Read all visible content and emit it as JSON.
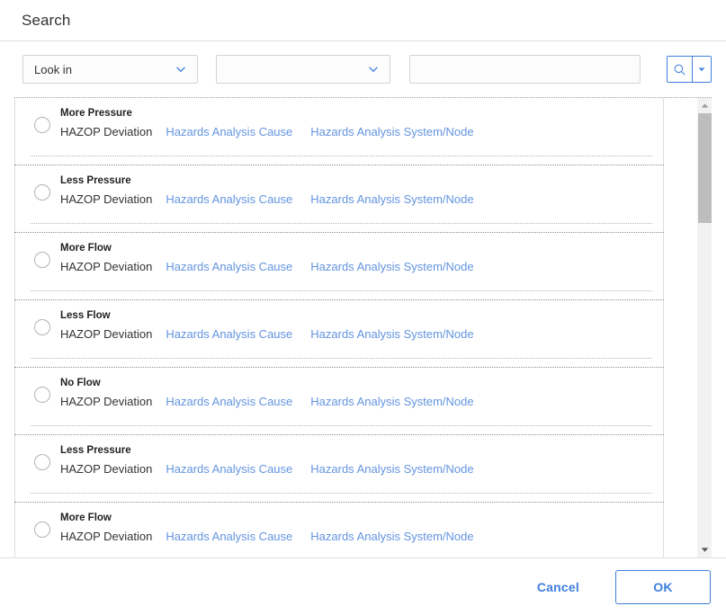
{
  "dialog": {
    "title": "Search"
  },
  "toolbar": {
    "look_in": {
      "label": "Look in",
      "icon": "chevron-down-icon"
    },
    "second_filter": {
      "label": "",
      "placeholder": "",
      "icon": "chevron-down-icon"
    },
    "search_text": {
      "value": "",
      "placeholder": ""
    },
    "search_button": {
      "icon": "search-icon"
    },
    "search_options_button": {
      "icon": "caret-down-icon"
    }
  },
  "results": {
    "rows": [
      {
        "title": "More Pressure",
        "family": "HAZOP Deviation",
        "link1": "Hazards Analysis Cause",
        "link2": "Hazards Analysis System/Node"
      },
      {
        "title": "Less Pressure",
        "family": "HAZOP Deviation",
        "link1": "Hazards Analysis Cause",
        "link2": "Hazards Analysis System/Node"
      },
      {
        "title": "More Flow",
        "family": "HAZOP Deviation",
        "link1": "Hazards Analysis Cause",
        "link2": "Hazards Analysis System/Node"
      },
      {
        "title": "Less Flow",
        "family": "HAZOP Deviation",
        "link1": "Hazards Analysis Cause",
        "link2": "Hazards Analysis System/Node"
      },
      {
        "title": "No Flow",
        "family": "HAZOP Deviation",
        "link1": "Hazards Analysis Cause",
        "link2": "Hazards Analysis System/Node"
      },
      {
        "title": "Less Pressure",
        "family": "HAZOP Deviation",
        "link1": "Hazards Analysis Cause",
        "link2": "Hazards Analysis System/Node"
      },
      {
        "title": "More Flow",
        "family": "HAZOP Deviation",
        "link1": "Hazards Analysis Cause",
        "link2": "Hazards Analysis System/Node"
      }
    ]
  },
  "scrollbar": {
    "up_icon": "scroll-up-arrow-icon",
    "down_icon": "scroll-down-arrow-icon"
  },
  "footer": {
    "cancel_label": "Cancel",
    "ok_label": "OK"
  },
  "colors": {
    "accent": "#3f7fdb",
    "link": "#6394e0",
    "text": "#333333",
    "border": "#dedede"
  }
}
